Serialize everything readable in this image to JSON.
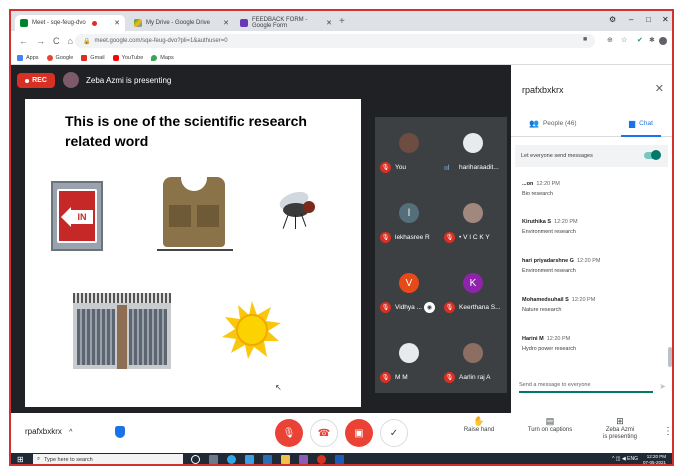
{
  "browser": {
    "tabs": [
      {
        "title": "Meet - sqe-feug-dvo",
        "active": true
      },
      {
        "title": "My Drive - Google Drive",
        "active": false
      },
      {
        "title": "FEEDBACK FORM - Google Form",
        "active": false
      }
    ],
    "url": "meet.google.com/sqe-feug-dvo?pli=1&authuser=0",
    "bookmarks": [
      "Apps",
      "Google",
      "Gmail",
      "YouTube",
      "Maps"
    ]
  },
  "meet": {
    "rec_label": "REC",
    "presenting_text": "Zeba Azmi is presenting",
    "slide": {
      "title": "This is one of the scientific research related word",
      "door_sign": "IN"
    },
    "participants": [
      {
        "name": "You",
        "muted": true,
        "color": "#5f6368"
      },
      {
        "name": "hariharaadit...",
        "muted": false,
        "color": "#e8eaed"
      },
      {
        "name": "lekhasree R",
        "muted": true,
        "letter": "l",
        "color": "#546e7a"
      },
      {
        "name": "• V I C K Y",
        "muted": true,
        "color": "#a1887f"
      },
      {
        "name": "Vidhya ...",
        "muted": true,
        "letter": "V",
        "color": "#e64a19"
      },
      {
        "name": "Keerthana S...",
        "muted": true,
        "letter": "K",
        "color": "#8e24aa"
      },
      {
        "name": "M M",
        "muted": true,
        "color": "#e8eaed"
      },
      {
        "name": "Aarlin raj A",
        "muted": true,
        "color": "#8d6e63"
      }
    ]
  },
  "panel": {
    "meeting_code": "rpafxbxkrx",
    "people_label": "People (46)",
    "chat_label": "Chat",
    "toggle_label": "Let everyone send messages",
    "messages": [
      {
        "author": "...on",
        "time": "12:20 PM",
        "text": "Bio research"
      },
      {
        "author": "Kiruthika S",
        "time": "12:20 PM",
        "text": "Environment research"
      },
      {
        "author": "hari priyadarshne G",
        "time": "12:20 PM",
        "text": "Environment research"
      },
      {
        "author": "Mohamedsuhail S",
        "time": "12:20 PM",
        "text": "Nature research"
      },
      {
        "author": "Harini M",
        "time": "12:20 PM",
        "text": "Hydro power research"
      }
    ],
    "send_placeholder": "Send a message to everyone"
  },
  "bottom": {
    "meeting_code": "rpafxbxkrx",
    "raise_hand": "Raise hand",
    "captions": "Turn on captions",
    "presenting_line1": "Zeba Azmi",
    "presenting_line2": "is presenting"
  },
  "taskbar": {
    "search_placeholder": "Type here to search",
    "lang": "ENG",
    "time": "12:20 PM",
    "date": "07-05-2021"
  }
}
